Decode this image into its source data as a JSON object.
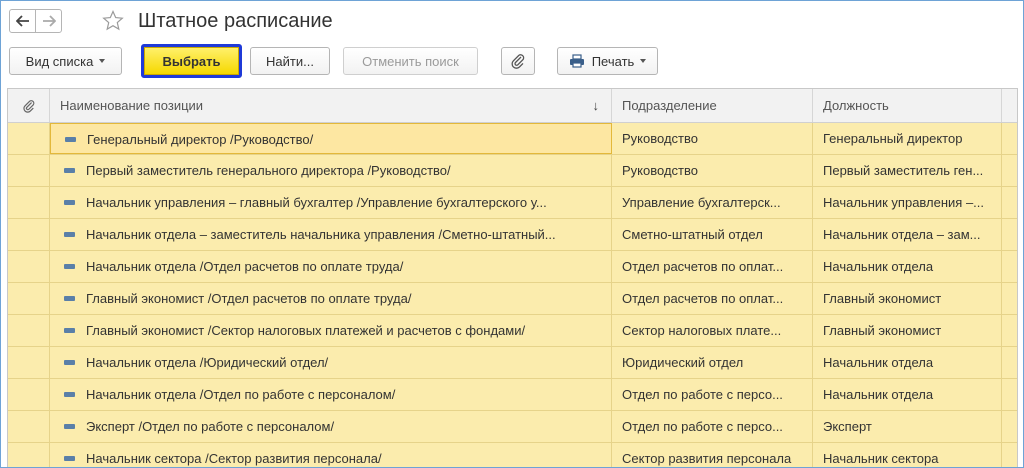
{
  "window": {
    "title": "Штатное расписание"
  },
  "toolbar": {
    "view_label": "Вид списка",
    "choose_label": "Выбрать",
    "find_label": "Найти...",
    "cancel_search_label": "Отменить поиск",
    "print_label": "Печать"
  },
  "table": {
    "columns": {
      "name": "Наименование позиции",
      "division": "Подразделение",
      "position": "Должность"
    },
    "rows": [
      {
        "name": "Генеральный директор /Руководство/",
        "division": "Руководство",
        "position": "Генеральный директор"
      },
      {
        "name": "Первый заместитель генерального директора /Руководство/",
        "division": "Руководство",
        "position": "Первый заместитель ген..."
      },
      {
        "name": "Начальник управления – главный бухгалтер /Управление бухгалтерского у...",
        "division": "Управление бухгалтерск...",
        "position": "Начальник управления –..."
      },
      {
        "name": "Начальник отдела – заместитель начальника управления /Сметно-штатный...",
        "division": "Сметно-штатный отдел",
        "position": "Начальник отдела – зам..."
      },
      {
        "name": "Начальник отдела /Отдел расчетов по оплате труда/",
        "division": "Отдел расчетов по оплат...",
        "position": "Начальник отдела"
      },
      {
        "name": "Главный экономист /Отдел расчетов по оплате труда/",
        "division": "Отдел расчетов по оплат...",
        "position": "Главный экономист"
      },
      {
        "name": "Главный экономист /Сектор налоговых платежей и расчетов с фондами/",
        "division": "Сектор налоговых плате...",
        "position": "Главный экономист"
      },
      {
        "name": "Начальник отдела /Юридический отдел/",
        "division": "Юридический отдел",
        "position": "Начальник отдела"
      },
      {
        "name": "Начальник отдела /Отдел по работе с персоналом/",
        "division": "Отдел по работе с персо...",
        "position": "Начальник отдела"
      },
      {
        "name": "Эксперт /Отдел по работе с персоналом/",
        "division": "Отдел по работе с персо...",
        "position": "Эксперт"
      },
      {
        "name": "Начальник сектора /Сектор развития персонала/",
        "division": "Сектор развития персонала",
        "position": "Начальник сектора"
      }
    ]
  },
  "colors": {
    "row_background": "#fbecad",
    "selected_border": "#e3b83a",
    "choose_button": "#f5d800",
    "focus_outline": "#1f3ad8"
  }
}
